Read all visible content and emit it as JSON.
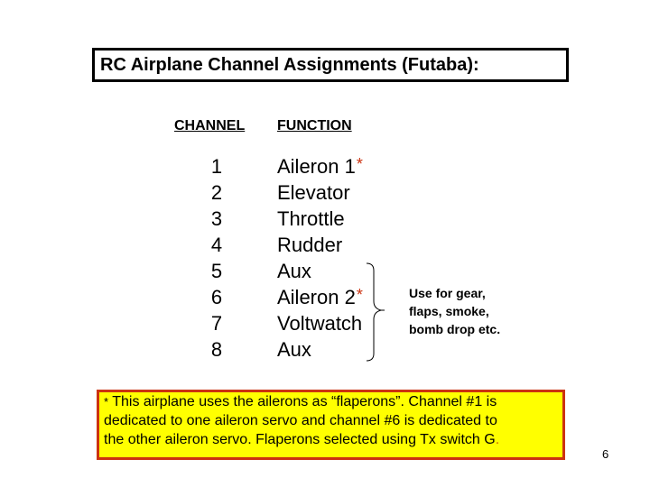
{
  "slide": {
    "title": "RC Airplane Channel Assignments (Futaba):",
    "page_number": "6"
  },
  "table": {
    "headers": {
      "channel": "CHANNEL",
      "function": "FUNCTION"
    },
    "rows": [
      {
        "channel": "1",
        "function": "Aileron 1",
        "asterisk": "*"
      },
      {
        "channel": "2",
        "function": "Elevator",
        "asterisk": ""
      },
      {
        "channel": "3",
        "function": "Throttle",
        "asterisk": ""
      },
      {
        "channel": "4",
        "function": "Rudder",
        "asterisk": ""
      },
      {
        "channel": "5",
        "function": "Aux",
        "asterisk": ""
      },
      {
        "channel": "6",
        "function": "Aileron 2",
        "asterisk": "*"
      },
      {
        "channel": "7",
        "function": "Voltwatch",
        "asterisk": ""
      },
      {
        "channel": "8",
        "function": "Aux",
        "asterisk": ""
      }
    ]
  },
  "brace_note": {
    "lines": [
      "Use for gear,",
      "flaps, smoke,",
      "bomb drop etc."
    ]
  },
  "footnote": {
    "star": "*",
    "lines": [
      " This airplane uses the ailerons as “flaperons”.  Channel #1 is",
      "dedicated to one aileron servo and channel #6 is dedicated to",
      "the other aileron servo.  Flaperons selected using Tx switch G"
    ],
    "trailing_period": "."
  },
  "colors": {
    "title_border": "#000000",
    "note_background": "#ffff00",
    "note_border": "#cc3311",
    "asterisk": "#cc3311"
  }
}
